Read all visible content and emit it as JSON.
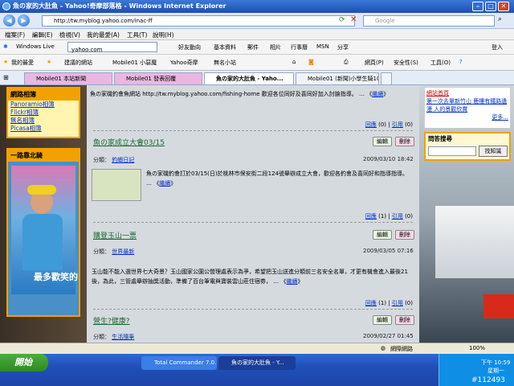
{
  "window": {
    "title": "魚の家的大肚魚 - Yahoo!奇摩部落格 - Windows Internet Explorer"
  },
  "address": {
    "url": "http://tw.myblog.yahoo.com/inac-ff",
    "search_placeholder": "Google"
  },
  "menu": [
    "檔案(F)",
    "編輯(E)",
    "檢視(V)",
    "我的最愛(A)",
    "工具(T)",
    "說明(H)"
  ],
  "livebar": {
    "label": "Windows Live",
    "search_value": "yahoo.com",
    "items": [
      "好友動向",
      "基本資料",
      "郵件",
      "相片",
      "行事曆",
      "MSN",
      "分享"
    ],
    "signin": "登入"
  },
  "favbar": {
    "label": "我的最愛",
    "items": [
      "建議的網站",
      "Mobile01 小惡魔",
      "Yahoo奇摩",
      "無名小站"
    ],
    "tools": [
      "網頁(P)",
      "安全性(S)",
      "工具(O)"
    ]
  },
  "tabs": [
    "Mobile01 本站新聞",
    "Mobile01 發表回覆",
    "魚の家的大肚魚 - Yaho...",
    "Mobile01 (新聞)小學生騎10..."
  ],
  "sidebar": {
    "album_title": "網路相簿",
    "albums": [
      "Panoramio相簿",
      "Flickr相簿",
      "無名相簿",
      "Picasa相簿"
    ],
    "photo_title": "一路靠北騎",
    "photo_caption": "最多歡笑的"
  },
  "right": {
    "top_link_partial": "網站首頁",
    "top_note": "第一次去單新竹山 鹿樓有鐵路遺漫 人的景觀欣賞",
    "more": "更多...",
    "search_title": "問答搜尋",
    "search_button": "找知識"
  },
  "main": {
    "intro": "魚の家磯釣會魚網站 http://tw.myblog.yahoo.com/fishing-home 歡迎各位同好及喜同好加入討論指導。",
    "read_more": "繼續",
    "labels": {
      "reply": "回應",
      "trackback": "引用",
      "edit": "編輯",
      "delete": "刪除",
      "category": "分類："
    },
    "posts": [
      {
        "counts": {
          "reply": "(0)",
          "trackback": "(0)"
        },
        "date": ""
      },
      {
        "title": "魚の家成立大會03/15",
        "category": "釣蝦日記",
        "date": "2009/03/10 18:42",
        "body": "魚の家磯釣會訂於03/15(日)於桃林市保安街二段124號舉辦成立大會，歡迎各釣會及喜同好和指導指導。",
        "more": "繼續",
        "counts": {
          "reply": "(1)",
          "trackback": "(0)"
        }
      },
      {
        "title": "購登玉山一票",
        "category": "世界最新",
        "date": "2009/03/05 07:16",
        "body": "玉山能不能入選世界七大奇景？玉山國家公園公營理處表示為爭，希望把玉山送進分類前三名安全名單，才更有機會進入最後21後，為此，三管處舉辦抽獎活動，準備了百台筆電與寶裝雲山莊住宿券，",
        "more": "繼續",
        "counts": {
          "reply": "(1)",
          "trackback": "(0)"
        }
      },
      {
        "title": "營生?健康?",
        "category": "生活隨筆",
        "date": "2009/02/27 01:45"
      }
    ]
  },
  "status": {
    "zone": "網際網路",
    "zoom": "100%"
  },
  "taskbar": {
    "start": "開始",
    "tasks": [
      "Total Commander 7.0...",
      "魚の家的大肚魚 - Y..."
    ],
    "time": "下午 10:59",
    "day": "星期一"
  },
  "watermark": "#112493"
}
